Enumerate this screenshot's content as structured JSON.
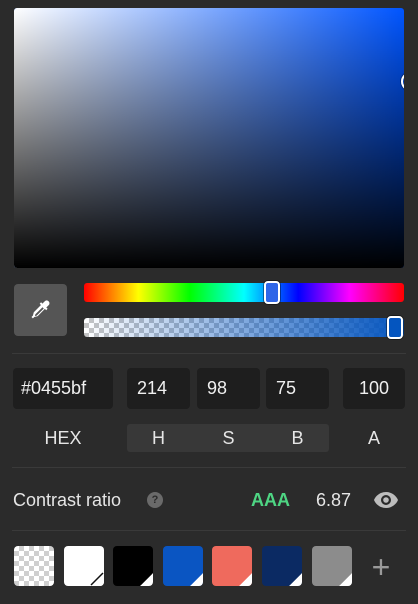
{
  "picker": {
    "current_color": "#0455bf",
    "hue_color": "#0055ff",
    "alpha": 1.0,
    "hue_degrees": 214
  },
  "fields": {
    "hex_value": "#0455bf",
    "h_value": "214",
    "s_value": "98",
    "b_value": "75",
    "a_value": "100"
  },
  "labels": {
    "hex": "HEX",
    "h": "H",
    "s": "S",
    "b": "B",
    "a": "A"
  },
  "contrast": {
    "label": "Contrast ratio",
    "help_glyph": "?",
    "grade": "AAA",
    "value": "6.87",
    "grade_color": "#4ed583"
  },
  "swatches": [
    {
      "name": "transparent",
      "color": "transparent"
    },
    {
      "name": "white",
      "color": "#ffffff"
    },
    {
      "name": "black",
      "color": "#000000"
    },
    {
      "name": "blue",
      "color": "#0a55c2"
    },
    {
      "name": "salmon",
      "color": "#ef6a5d"
    },
    {
      "name": "navy",
      "color": "#0b2a63"
    },
    {
      "name": "gray",
      "color": "#8c8c8c"
    }
  ],
  "add_swatch_glyph": "+",
  "icons": {
    "eyedropper": "eyedropper-icon",
    "help": "help-icon",
    "eye": "eye-icon",
    "add": "plus-icon"
  }
}
